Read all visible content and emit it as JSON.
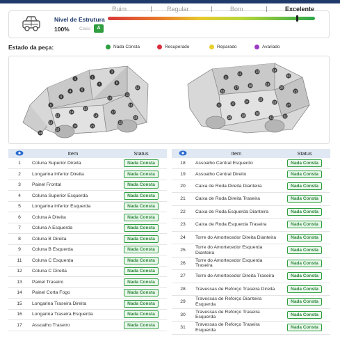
{
  "score": {
    "title": "Nível de Estrutura",
    "percent": "100%",
    "class_label": "Class",
    "class_value": "A",
    "scale": [
      "Ruim",
      "Regular",
      "Bom",
      "Excelente"
    ],
    "active_level": "Excelente"
  },
  "legend": {
    "title": "Estado da peça:",
    "items": [
      {
        "label": "Nada Consta",
        "color": "#2e9e3e"
      },
      {
        "label": "Recuperado",
        "color": "#d92b3a"
      },
      {
        "label": "Reparado",
        "color": "#e8cf2d"
      },
      {
        "label": "Avariado",
        "color": "#9b3bc4"
      }
    ]
  },
  "car_views": {
    "front_markers": [
      "1",
      "2",
      "3",
      "4",
      "5",
      "6",
      "7",
      "8",
      "9",
      "10",
      "11",
      "12",
      "13",
      "14",
      "15",
      "16",
      "17",
      "18",
      "19",
      "20",
      "21",
      "22",
      "23",
      "24",
      "25"
    ],
    "rear_markers": [
      "11",
      "12",
      "13",
      "14",
      "15",
      "16",
      "17",
      "18",
      "19",
      "20",
      "21",
      "22",
      "23",
      "24",
      "25",
      "26",
      "27",
      "28",
      "29",
      "30",
      "31",
      "32"
    ]
  },
  "table": {
    "col_item": "Item",
    "col_status": "Status",
    "left_rows": [
      {
        "n": "1",
        "item": "Coluna Superior Direita",
        "status": "Nada Consta"
      },
      {
        "n": "2",
        "item": "Longarina Inferior Direita",
        "status": "Nada Consta"
      },
      {
        "n": "3",
        "item": "Painel Frontal",
        "status": "Nada Consta"
      },
      {
        "n": "4",
        "item": "Coluna Superior Esquerda",
        "status": "Nada Consta"
      },
      {
        "n": "5",
        "item": "Longarina Inferior Esquerda",
        "status": "Nada Consta"
      },
      {
        "n": "6",
        "item": "Coluna A Direita",
        "status": "Nada Consta"
      },
      {
        "n": "7",
        "item": "Coluna A Esquerda",
        "status": "Nada Consta"
      },
      {
        "n": "8",
        "item": "Coluna B Direita",
        "status": "Nada Consta"
      },
      {
        "n": "9",
        "item": "Coluna B Esquerda",
        "status": "Nada Consta"
      },
      {
        "n": "11",
        "item": "Coluna C Esquerda",
        "status": "Nada Consta"
      },
      {
        "n": "12",
        "item": "Coluna C Direita",
        "status": "Nada Consta"
      },
      {
        "n": "13",
        "item": "Painel Traseiro",
        "status": "Nada Consta"
      },
      {
        "n": "14",
        "item": "Painel Corta Fogo",
        "status": "Nada Consta"
      },
      {
        "n": "15",
        "item": "Longarina Traseira Direita",
        "status": "Nada Consta"
      },
      {
        "n": "16",
        "item": "Longarina Traseira Esquerda",
        "status": "Nada Consta"
      },
      {
        "n": "17",
        "item": "Assoalho Traseiro",
        "status": "Nada Consta"
      }
    ],
    "right_rows": [
      {
        "n": "18",
        "item": "Assoalho Central Esquerdo",
        "status": "Nada Consta"
      },
      {
        "n": "19",
        "item": "Assoalho Central Direito",
        "status": "Nada Consta"
      },
      {
        "n": "20",
        "item": "Caixa de Roda Direita Dianteira",
        "status": "Nada Consta"
      },
      {
        "n": "21",
        "item": "Caixa de Roda Direita Traseira",
        "status": "Nada Consta"
      },
      {
        "n": "22",
        "item": "Caixa de Roda Esquerda Dianteira",
        "status": "Nada Consta"
      },
      {
        "n": "23",
        "item": "Caixa de Roda Esquerda Traseira",
        "status": "Nada Consta"
      },
      {
        "n": "24",
        "item": "Torre do Amortecedor Direita Dianteira",
        "status": "Nada Consta"
      },
      {
        "n": "25",
        "item": "Torre do Amortecedor Esquerda Dianteira",
        "status": "Nada Consta"
      },
      {
        "n": "26",
        "item": "Torre do Amortecedor Esquerda Traseira",
        "status": "Nada Consta"
      },
      {
        "n": "27",
        "item": "Torre do Amortecedor Direita Traseira",
        "status": "Nada Consta"
      },
      {
        "n": "28",
        "item": "Travessas de Reforço Traseira Direita",
        "status": "Nada Consta"
      },
      {
        "n": "29",
        "item": "Travessas de Reforço Dianteira Esquerda",
        "status": "Nada Consta"
      },
      {
        "n": "30",
        "item": "Travessas de Reforço Traseira Esquerda",
        "status": "Nada Consta"
      },
      {
        "n": "31",
        "item": "Travessas de Reforço Traseira Esquerda",
        "status": "Nada Consta"
      }
    ]
  }
}
